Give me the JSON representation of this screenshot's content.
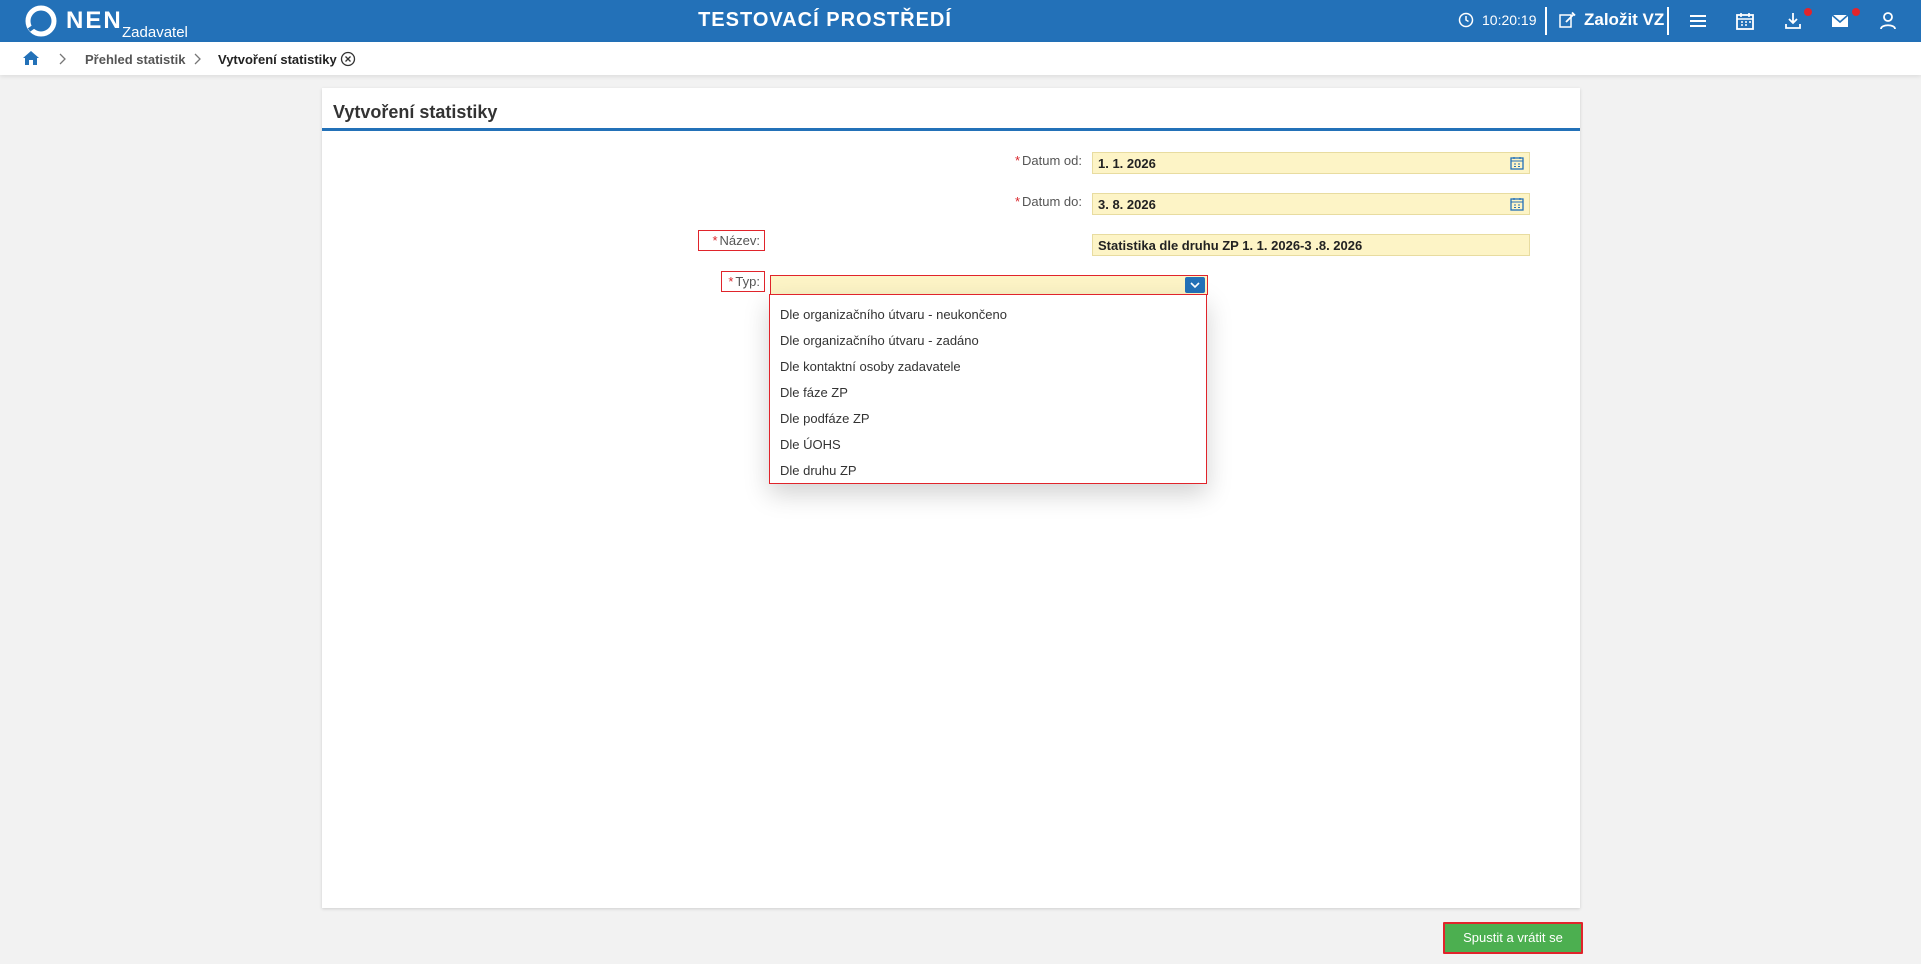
{
  "header": {
    "logo_text": "NEN",
    "logo_sub": "Zadavatel",
    "env_title": "TESTOVACÍ PROSTŘEDÍ",
    "clock": "10:20:19",
    "create_label": "Založit VZ",
    "brand_color": "#2371b8"
  },
  "breadcrumb": {
    "items": [
      "Přehled statistik",
      "Vytvoření statistiky"
    ]
  },
  "form": {
    "title": "Vytvoření statistiky",
    "required_mark": "*",
    "date_from_label": "Datum od:",
    "date_from_value": "1. 1. 2026",
    "date_to_label": "Datum do:",
    "date_to_value": "3. 8. 2026",
    "name_label": "Název:",
    "name_value": "Statistika dle druhu ZP 1. 1. 2026-3 .8. 2026",
    "type_label": "Typ:",
    "type_value": "",
    "type_options": [
      "Dle organizačního útvaru - neukončeno",
      "Dle organizačního útvaru - zadáno",
      "Dle kontaktní osoby zadavatele",
      "Dle fáze ZP",
      "Dle podfáze ZP",
      "Dle ÚOHS",
      "Dle druhu ZP"
    ]
  },
  "actions": {
    "run_label": "Spustit a vrátit se",
    "run_color": "#4caf50"
  }
}
